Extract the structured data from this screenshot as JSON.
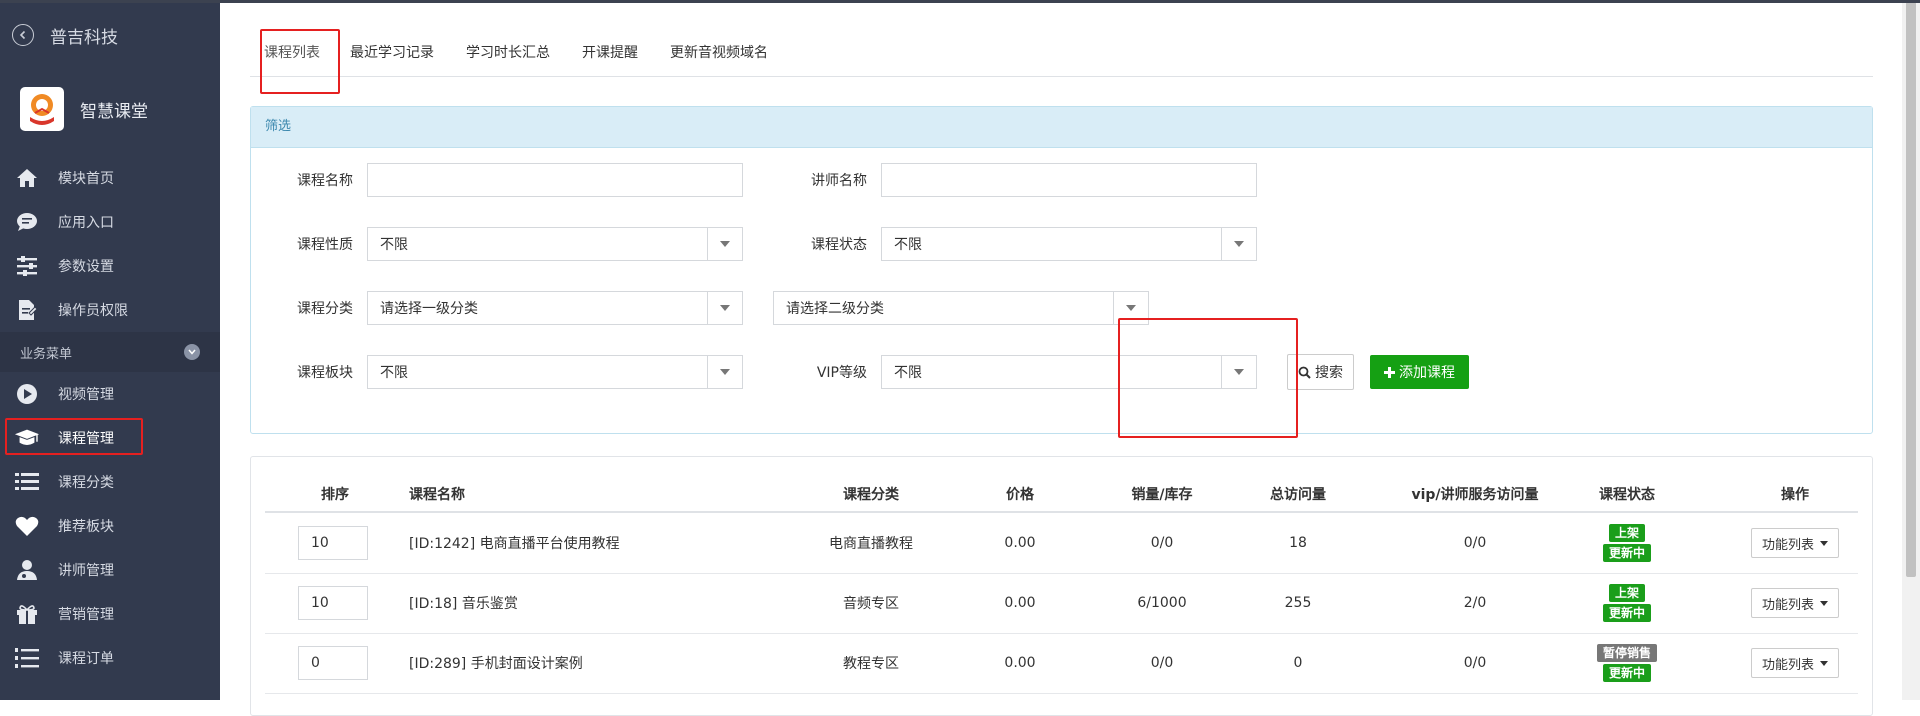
{
  "sidebar": {
    "company": "普吉科技",
    "app_name": "智慧课堂",
    "items": [
      {
        "label": "模块首页",
        "icon": "home-icon"
      },
      {
        "label": "应用入口",
        "icon": "chat-bubble-icon"
      },
      {
        "label": "参数设置",
        "icon": "sliders-icon"
      },
      {
        "label": "操作员权限",
        "icon": "document-edit-icon"
      }
    ],
    "section_label": "业务菜单",
    "business_items": [
      {
        "label": "视频管理",
        "icon": "play-circle-icon"
      },
      {
        "label": "课程管理",
        "icon": "graduation-cap-icon"
      },
      {
        "label": "课程分类",
        "icon": "list-icon"
      },
      {
        "label": "推荐板块",
        "icon": "heart-icon"
      },
      {
        "label": "讲师管理",
        "icon": "teacher-icon"
      },
      {
        "label": "营销管理",
        "icon": "gift-icon"
      },
      {
        "label": "课程订单",
        "icon": "ordered-list-icon"
      }
    ]
  },
  "tabs": [
    "课程列表",
    "最近学习记录",
    "学习时长汇总",
    "开课提醒",
    "更新音视频域名"
  ],
  "filter": {
    "title": "筛选",
    "course_name_label": "课程名称",
    "teacher_name_label": "讲师名称",
    "course_nature_label": "课程性质",
    "course_nature_value": "不限",
    "course_status_label": "课程状态",
    "course_status_value": "不限",
    "category_label": "课程分类",
    "category1_value": "请选择一级分类",
    "category2_value": "请选择二级分类",
    "block_label": "课程板块",
    "block_value": "不限",
    "vip_label": "VIP等级",
    "vip_value": "不限",
    "search_label": "搜索",
    "add_label": "添加课程"
  },
  "table": {
    "headers": [
      "排序",
      "课程名称",
      "课程分类",
      "价格",
      "销量/库存",
      "总访问量",
      "vip/讲师服务访问量",
      "课程状态",
      "操作"
    ],
    "rows": [
      {
        "sort": "10",
        "name": "[ID:1242] 电商直播平台使用教程",
        "category": "电商直播教程",
        "price": "0.00",
        "sales": "0/0",
        "visits": "18",
        "vip_visits": "0/0",
        "status1": "上架",
        "status1_color": "#1a9e1a",
        "status2": "更新中",
        "status2_color": "#1a9e1a",
        "action": "功能列表"
      },
      {
        "sort": "10",
        "name": "[ID:18] 音乐鉴赏",
        "category": "音频专区",
        "price": "0.00",
        "sales": "6/1000",
        "visits": "255",
        "vip_visits": "2/0",
        "status1": "上架",
        "status1_color": "#1a9e1a",
        "status2": "更新中",
        "status2_color": "#1a9e1a",
        "action": "功能列表"
      },
      {
        "sort": "0",
        "name": "[ID:289] 手机封面设计案例",
        "category": "教程专区",
        "price": "0.00",
        "sales": "0/0",
        "visits": "0",
        "vip_visits": "0/0",
        "status1": "暂停销售",
        "status1_color": "#777777",
        "status2": "更新中",
        "status2_color": "#1a9e1a",
        "action": "功能列表"
      }
    ]
  }
}
